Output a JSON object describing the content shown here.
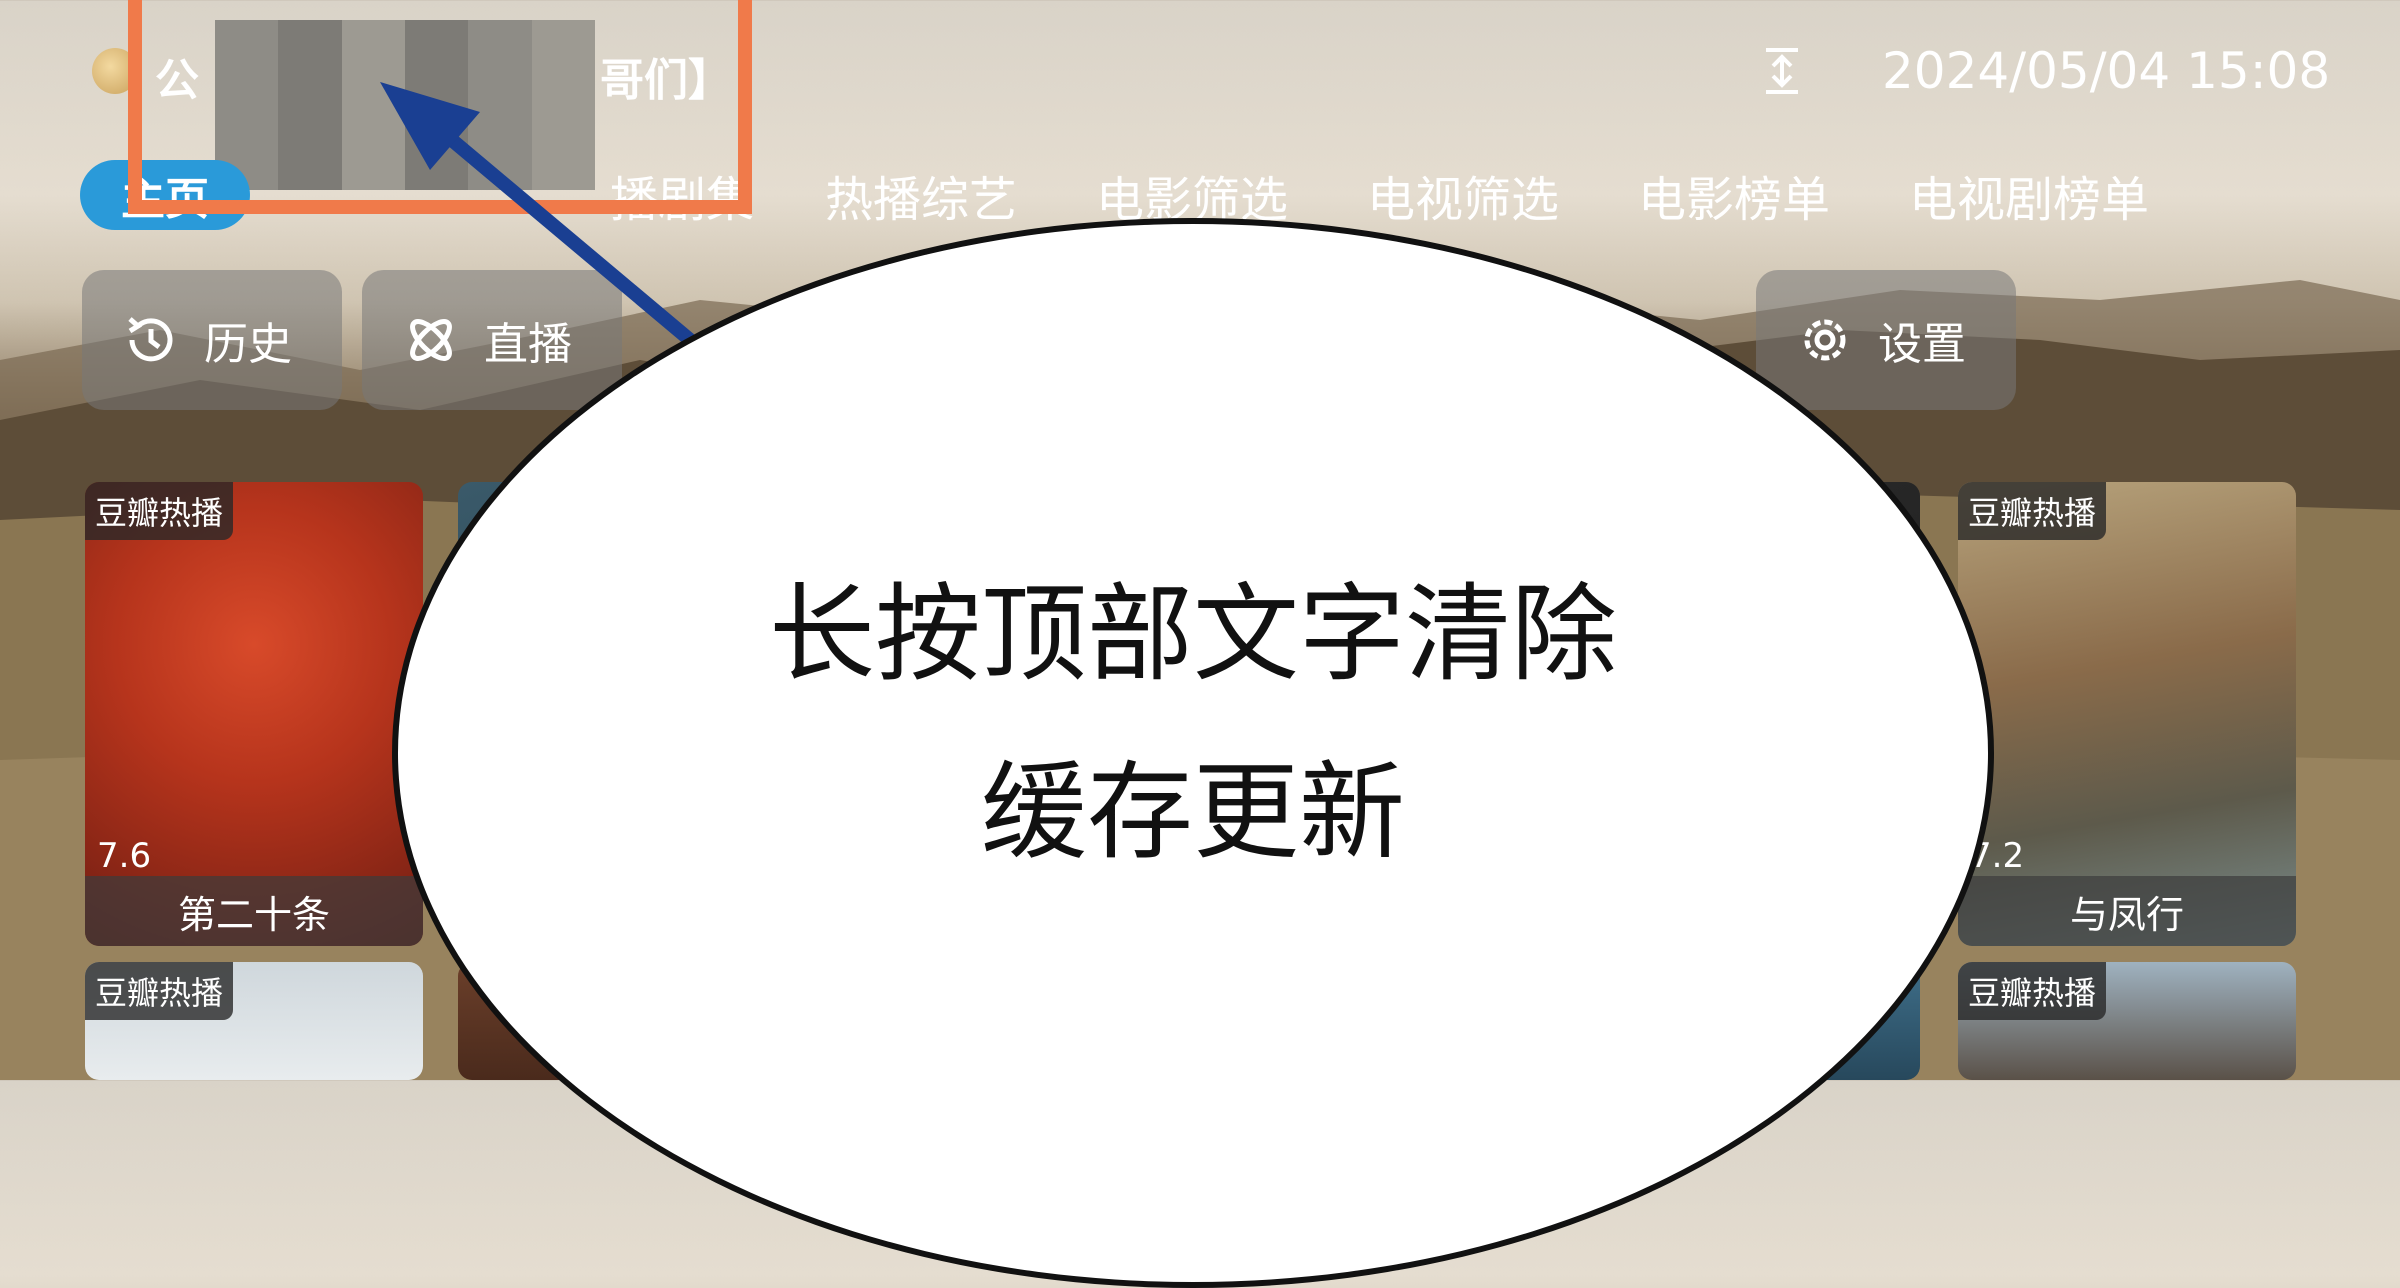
{
  "header": {
    "title_start": "公",
    "title_end": "哥们】",
    "datetime": "2024/05/04 15:08"
  },
  "tabs": [
    {
      "label": "主页"
    },
    {
      "label": "播剧集"
    },
    {
      "label": "热播综艺"
    },
    {
      "label": "电影筛选"
    },
    {
      "label": "电视筛选"
    },
    {
      "label": "电影榜单"
    },
    {
      "label": "电视剧榜单"
    }
  ],
  "quick_actions": [
    {
      "label": "历史",
      "icon": "history-icon"
    },
    {
      "label": "直播",
      "icon": "live-icon"
    },
    {
      "label": "设置",
      "icon": "gear-icon"
    }
  ],
  "cards": [
    {
      "badge": "豆瓣热播",
      "score": "7.6",
      "title": "第二十条"
    },
    {
      "badge": "豆瓣热播",
      "score": "7.2",
      "title": "与凤行"
    },
    {
      "badge": "豆瓣热播"
    },
    {
      "badge": "豆瓣热播"
    }
  ],
  "overlay": {
    "line1": "长按顶部文字清除",
    "line2": "缓存更新",
    "accent_color": "#f07a4a",
    "arrow_color": "#1a3f92"
  }
}
